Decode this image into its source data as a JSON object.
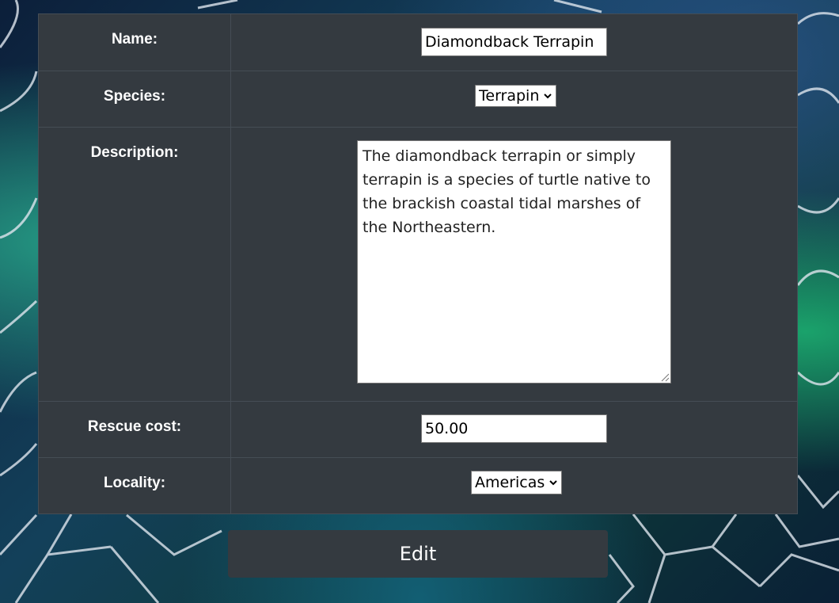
{
  "form": {
    "name": {
      "label": "Name:",
      "value": "Diamondback Terrapin"
    },
    "species": {
      "label": "Species:",
      "selected": "Terrapin"
    },
    "description": {
      "label": "Description:",
      "value": "The diamondback terrapin or simply terrapin is a species of turtle native to the brackish coastal tidal marshes of the Northeastern."
    },
    "rescue_cost": {
      "label": "Rescue cost:",
      "value": "50.00"
    },
    "locality": {
      "label": "Locality:",
      "selected": "Americas"
    }
  },
  "actions": {
    "edit_label": "Edit"
  },
  "colors": {
    "panel_bg": "#343a40",
    "panel_border": "#454d55",
    "text": "#ffffff",
    "background_art": "turtle-shell-scales"
  }
}
